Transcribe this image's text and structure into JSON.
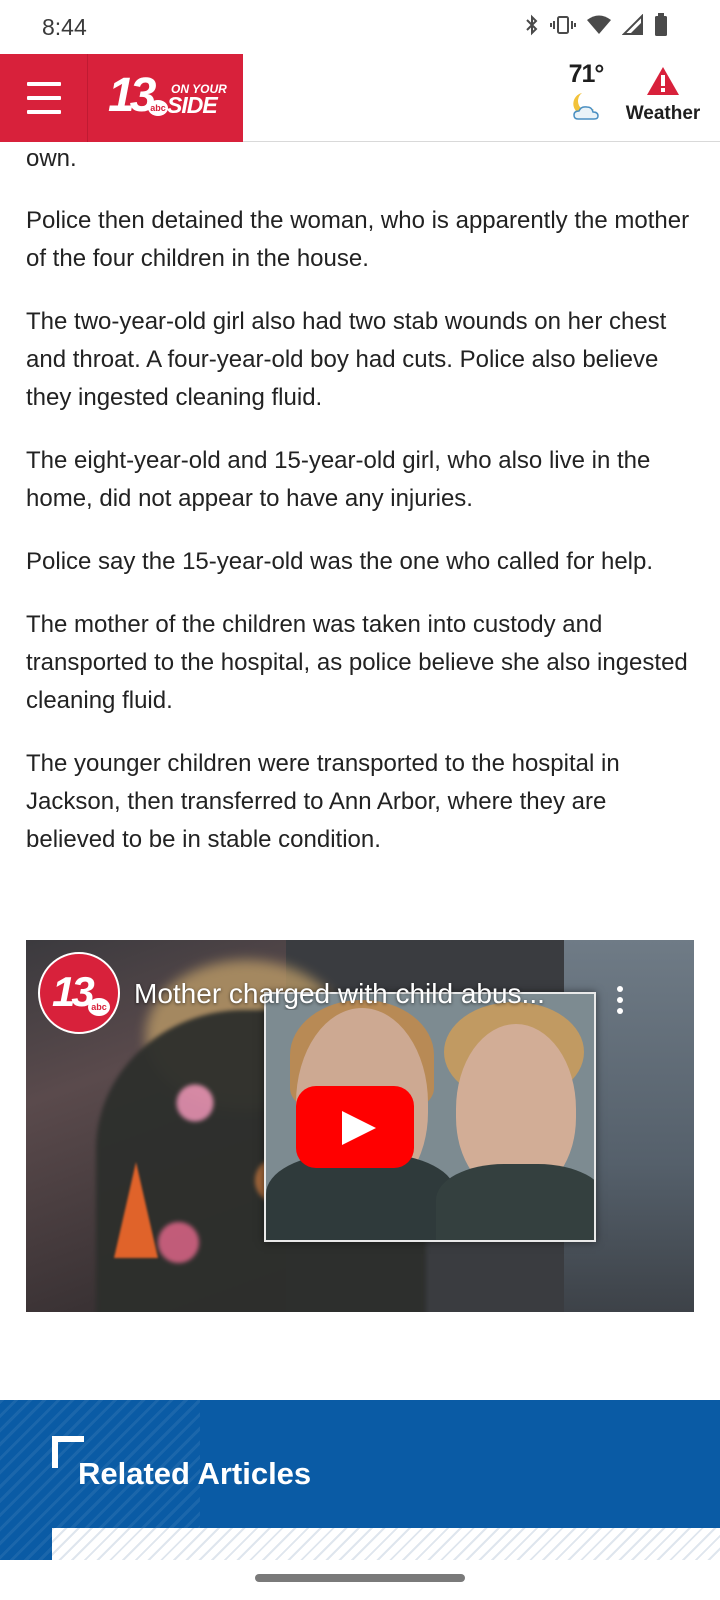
{
  "status_bar": {
    "time": "8:44",
    "icons": [
      "bluetooth-icon",
      "vibrate-icon",
      "wifi-icon",
      "signal-icon",
      "battery-icon"
    ]
  },
  "header": {
    "logo": {
      "number": "13",
      "network": "abc",
      "tagline_top": "ON YOUR",
      "tagline_bottom": "SIDE"
    },
    "weather": {
      "temperature": "71°",
      "condition_icon": "moon-cloud-icon",
      "alert_icon": "alert-triangle-icon",
      "label": "Weather"
    },
    "colors": {
      "brand_red": "#d8213b",
      "alert_red": "#d8213b"
    }
  },
  "article": {
    "paragraphs": [
      "own.",
      "Police then detained the woman, who is apparently the mother of the four children in the house.",
      "The two-year-old girl also had two stab wounds on her chest and throat. A four-year-old boy had cuts. Police also believe they ingested cleaning fluid.",
      "The eight-year-old and 15-year-old girl, who also live in the home, did not appear to have any injuries.",
      "Police say the 15-year-old was the one who called for help.",
      "The mother of the children was taken into custody and transported to the hospital, as police believe she also ingested cleaning fluid.",
      "The younger children were transported to the hospital in Jackson, then transferred to Ann Arbor, where they are believed to be in stable condition."
    ]
  },
  "video": {
    "title": "Mother charged with child abus...",
    "channel_avatar": {
      "number": "13",
      "network": "abc"
    },
    "play_color": "#ff0000"
  },
  "related": {
    "title": "Related Articles",
    "color": "#0a5ba5"
  }
}
